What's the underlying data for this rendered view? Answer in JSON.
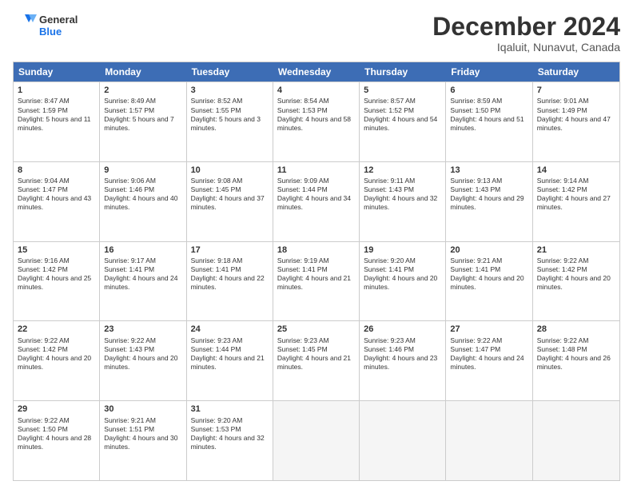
{
  "header": {
    "logo_line1": "General",
    "logo_line2": "Blue",
    "month_title": "December 2024",
    "subtitle": "Iqaluit, Nunavut, Canada"
  },
  "calendar": {
    "headers": [
      "Sunday",
      "Monday",
      "Tuesday",
      "Wednesday",
      "Thursday",
      "Friday",
      "Saturday"
    ],
    "rows": [
      [
        {
          "day": "1",
          "sunrise": "Sunrise: 8:47 AM",
          "sunset": "Sunset: 1:59 PM",
          "daylight": "Daylight: 5 hours and 11 minutes."
        },
        {
          "day": "2",
          "sunrise": "Sunrise: 8:49 AM",
          "sunset": "Sunset: 1:57 PM",
          "daylight": "Daylight: 5 hours and 7 minutes."
        },
        {
          "day": "3",
          "sunrise": "Sunrise: 8:52 AM",
          "sunset": "Sunset: 1:55 PM",
          "daylight": "Daylight: 5 hours and 3 minutes."
        },
        {
          "day": "4",
          "sunrise": "Sunrise: 8:54 AM",
          "sunset": "Sunset: 1:53 PM",
          "daylight": "Daylight: 4 hours and 58 minutes."
        },
        {
          "day": "5",
          "sunrise": "Sunrise: 8:57 AM",
          "sunset": "Sunset: 1:52 PM",
          "daylight": "Daylight: 4 hours and 54 minutes."
        },
        {
          "day": "6",
          "sunrise": "Sunrise: 8:59 AM",
          "sunset": "Sunset: 1:50 PM",
          "daylight": "Daylight: 4 hours and 51 minutes."
        },
        {
          "day": "7",
          "sunrise": "Sunrise: 9:01 AM",
          "sunset": "Sunset: 1:49 PM",
          "daylight": "Daylight: 4 hours and 47 minutes."
        }
      ],
      [
        {
          "day": "8",
          "sunrise": "Sunrise: 9:04 AM",
          "sunset": "Sunset: 1:47 PM",
          "daylight": "Daylight: 4 hours and 43 minutes."
        },
        {
          "day": "9",
          "sunrise": "Sunrise: 9:06 AM",
          "sunset": "Sunset: 1:46 PM",
          "daylight": "Daylight: 4 hours and 40 minutes."
        },
        {
          "day": "10",
          "sunrise": "Sunrise: 9:08 AM",
          "sunset": "Sunset: 1:45 PM",
          "daylight": "Daylight: 4 hours and 37 minutes."
        },
        {
          "day": "11",
          "sunrise": "Sunrise: 9:09 AM",
          "sunset": "Sunset: 1:44 PM",
          "daylight": "Daylight: 4 hours and 34 minutes."
        },
        {
          "day": "12",
          "sunrise": "Sunrise: 9:11 AM",
          "sunset": "Sunset: 1:43 PM",
          "daylight": "Daylight: 4 hours and 32 minutes."
        },
        {
          "day": "13",
          "sunrise": "Sunrise: 9:13 AM",
          "sunset": "Sunset: 1:43 PM",
          "daylight": "Daylight: 4 hours and 29 minutes."
        },
        {
          "day": "14",
          "sunrise": "Sunrise: 9:14 AM",
          "sunset": "Sunset: 1:42 PM",
          "daylight": "Daylight: 4 hours and 27 minutes."
        }
      ],
      [
        {
          "day": "15",
          "sunrise": "Sunrise: 9:16 AM",
          "sunset": "Sunset: 1:42 PM",
          "daylight": "Daylight: 4 hours and 25 minutes."
        },
        {
          "day": "16",
          "sunrise": "Sunrise: 9:17 AM",
          "sunset": "Sunset: 1:41 PM",
          "daylight": "Daylight: 4 hours and 24 minutes."
        },
        {
          "day": "17",
          "sunrise": "Sunrise: 9:18 AM",
          "sunset": "Sunset: 1:41 PM",
          "daylight": "Daylight: 4 hours and 22 minutes."
        },
        {
          "day": "18",
          "sunrise": "Sunrise: 9:19 AM",
          "sunset": "Sunset: 1:41 PM",
          "daylight": "Daylight: 4 hours and 21 minutes."
        },
        {
          "day": "19",
          "sunrise": "Sunrise: 9:20 AM",
          "sunset": "Sunset: 1:41 PM",
          "daylight": "Daylight: 4 hours and 20 minutes."
        },
        {
          "day": "20",
          "sunrise": "Sunrise: 9:21 AM",
          "sunset": "Sunset: 1:41 PM",
          "daylight": "Daylight: 4 hours and 20 minutes."
        },
        {
          "day": "21",
          "sunrise": "Sunrise: 9:22 AM",
          "sunset": "Sunset: 1:42 PM",
          "daylight": "Daylight: 4 hours and 20 minutes."
        }
      ],
      [
        {
          "day": "22",
          "sunrise": "Sunrise: 9:22 AM",
          "sunset": "Sunset: 1:42 PM",
          "daylight": "Daylight: 4 hours and 20 minutes."
        },
        {
          "day": "23",
          "sunrise": "Sunrise: 9:22 AM",
          "sunset": "Sunset: 1:43 PM",
          "daylight": "Daylight: 4 hours and 20 minutes."
        },
        {
          "day": "24",
          "sunrise": "Sunrise: 9:23 AM",
          "sunset": "Sunset: 1:44 PM",
          "daylight": "Daylight: 4 hours and 21 minutes."
        },
        {
          "day": "25",
          "sunrise": "Sunrise: 9:23 AM",
          "sunset": "Sunset: 1:45 PM",
          "daylight": "Daylight: 4 hours and 21 minutes."
        },
        {
          "day": "26",
          "sunrise": "Sunrise: 9:23 AM",
          "sunset": "Sunset: 1:46 PM",
          "daylight": "Daylight: 4 hours and 23 minutes."
        },
        {
          "day": "27",
          "sunrise": "Sunrise: 9:22 AM",
          "sunset": "Sunset: 1:47 PM",
          "daylight": "Daylight: 4 hours and 24 minutes."
        },
        {
          "day": "28",
          "sunrise": "Sunrise: 9:22 AM",
          "sunset": "Sunset: 1:48 PM",
          "daylight": "Daylight: 4 hours and 26 minutes."
        }
      ],
      [
        {
          "day": "29",
          "sunrise": "Sunrise: 9:22 AM",
          "sunset": "Sunset: 1:50 PM",
          "daylight": "Daylight: 4 hours and 28 minutes."
        },
        {
          "day": "30",
          "sunrise": "Sunrise: 9:21 AM",
          "sunset": "Sunset: 1:51 PM",
          "daylight": "Daylight: 4 hours and 30 minutes."
        },
        {
          "day": "31",
          "sunrise": "Sunrise: 9:20 AM",
          "sunset": "Sunset: 1:53 PM",
          "daylight": "Daylight: 4 hours and 32 minutes."
        },
        {
          "day": "",
          "sunrise": "",
          "sunset": "",
          "daylight": ""
        },
        {
          "day": "",
          "sunrise": "",
          "sunset": "",
          "daylight": ""
        },
        {
          "day": "",
          "sunrise": "",
          "sunset": "",
          "daylight": ""
        },
        {
          "day": "",
          "sunrise": "",
          "sunset": "",
          "daylight": ""
        }
      ]
    ]
  }
}
